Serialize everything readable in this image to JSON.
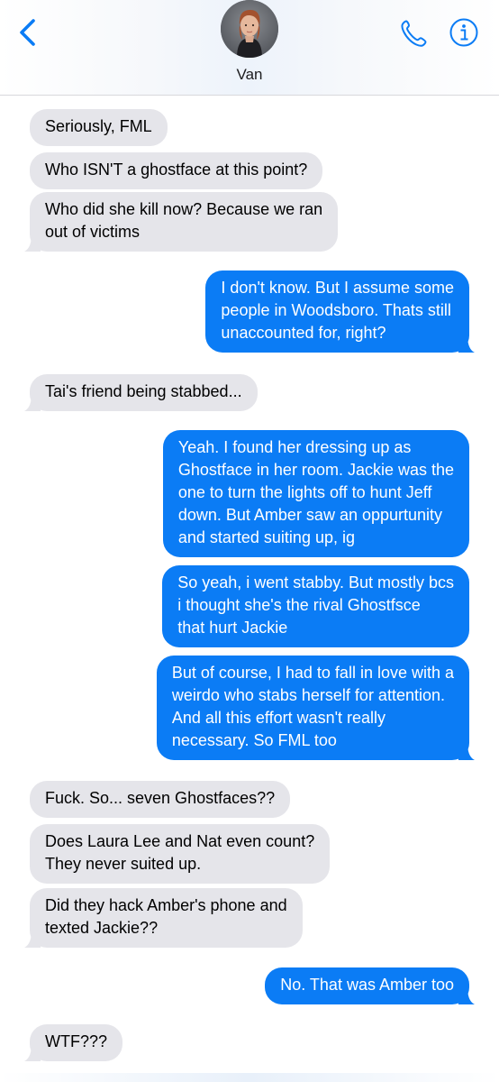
{
  "header": {
    "contact_name": "Van",
    "back_icon": "chevron-left-icon",
    "phone_icon": "phone-icon",
    "info_icon": "info-icon",
    "accent_color": "#0b7cf5"
  },
  "messages": [
    {
      "direction": "incoming",
      "lines": [
        "Seriously, FML"
      ]
    },
    {
      "direction": "incoming",
      "lines": [
        "Who ISN'T a ghostface at this point?"
      ]
    },
    {
      "direction": "incoming",
      "lines": [
        "Who did she kill now? Because we ran",
        "out of victims"
      ]
    },
    {
      "direction": "outgoing",
      "lines": [
        "I don't know. But I assume some",
        "people in Woodsboro. Thats still",
        "unaccounted for, right?"
      ]
    },
    {
      "direction": "incoming",
      "lines": [
        "Tai's friend being stabbed..."
      ]
    },
    {
      "direction": "outgoing",
      "lines": [
        "Yeah. I found her dressing up as",
        "Ghostface in her room. Jackie was the",
        "one to turn the lights off to hunt Jeff",
        "down. But Amber saw an oppurtunity",
        "and started suiting up, ig"
      ]
    },
    {
      "direction": "outgoing",
      "lines": [
        "So yeah, i went stabby. But mostly bcs",
        "i thought she's the rival Ghostfsce",
        "that hurt Jackie"
      ]
    },
    {
      "direction": "outgoing",
      "lines": [
        "But of course, I had to fall in love with a",
        "weirdo who stabs herself for attention.",
        "And all this effort wasn't really",
        "necessary. So FML too"
      ]
    },
    {
      "direction": "incoming",
      "lines": [
        "Fuck. So... seven Ghostfaces??"
      ]
    },
    {
      "direction": "incoming",
      "lines": [
        "Does Laura Lee and Nat even count?",
        "They never suited up."
      ]
    },
    {
      "direction": "incoming",
      "lines": [
        "Did they hack Amber's phone and",
        "texted Jackie??"
      ]
    },
    {
      "direction": "outgoing",
      "lines": [
        "No. That was Amber too"
      ]
    },
    {
      "direction": "incoming",
      "lines": [
        "WTF???"
      ]
    }
  ]
}
